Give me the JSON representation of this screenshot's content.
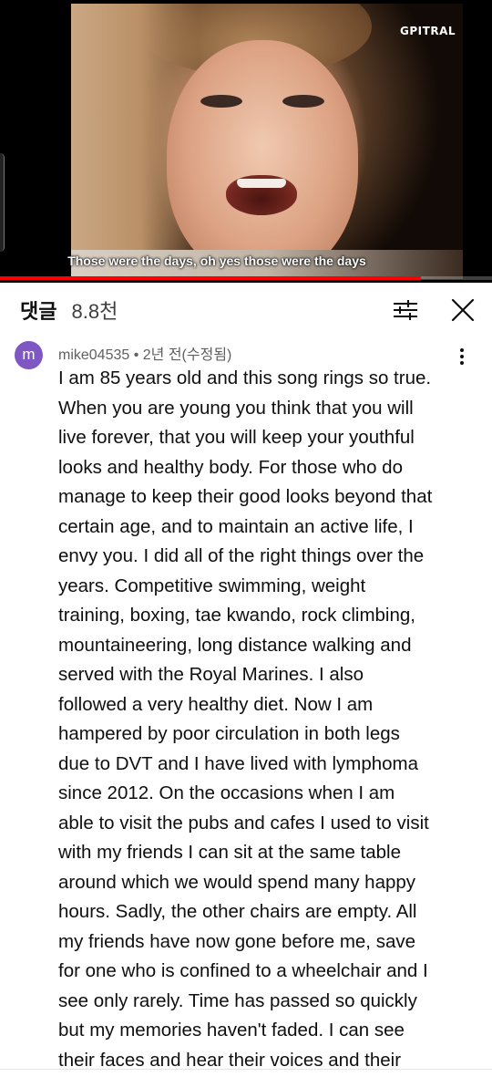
{
  "video": {
    "brand_watermark": "GPITRAL",
    "subtitle": "Those were the days, oh yes those were the days",
    "progress_fraction": 0.855,
    "progress_color": "#ff0000"
  },
  "comments_header": {
    "title": "댓글",
    "count": "8.8천",
    "filter_icon": "sort-filter-icon",
    "close_icon": "close-icon"
  },
  "comment": {
    "avatar_letter": "m",
    "avatar_color": "#7e57c2",
    "meta": "mike04535 • 2년 전(수정됨)",
    "menu_icon": "more-vert-icon",
    "text": "I am 85 years old and this song rings so true.\nWhen you are young you think that you will\nlive forever, that you will keep your youthful\nlooks and healthy body. For those who do\nmanage to keep their good looks beyond that\ncertain age, and to maintain an active life, I\nenvy you. I did all of the right things over the\nyears. Competitive swimming, weight\ntraining, boxing, tae kwando, rock climbing,\nmountaineering, long distance walking and\nserved with the Royal Marines. I also\nfollowed a very healthy diet. Now I am\nhampered by poor circulation in both legs\ndue to DVT and I have lived with lymphoma\nsince 2012. On the occasions when I am\nable to visit the pubs and cafes I used to visit\nwith my friends I can sit at the same table\naround which we would spend many happy\nhours. Sadly, the other chairs are empty. All\nmy friends have now gone before me, save\nfor one who is confined to a wheelchair and I\nsee only rarely. Time has passed so quickly\nbut my memories haven't faded. I can see\ntheir faces and hear their voices and their"
  }
}
